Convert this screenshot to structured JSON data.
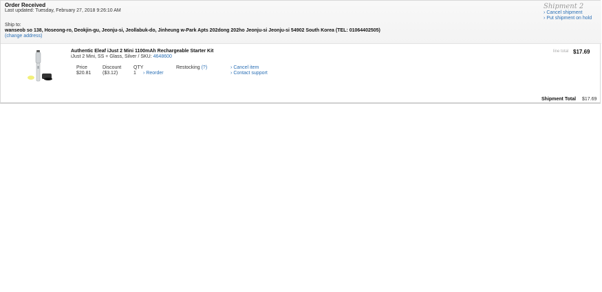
{
  "order": {
    "status": "Order Received",
    "last_updated": "Last updated: Tuesday, February 27, 2018 9:26:10 AM",
    "ship_to_label": "Ship to:",
    "address": "wanseob so 138, Hoseong-ro, Deokjin-gu, Jeonju-si, Jeollabuk-do, Jinheung w-Park Apts 202dong 202ho Jeonju-si Jeonju-si 54902 South Korea (TEL: 01064402505)",
    "change_address": "(change address)"
  },
  "shipment": {
    "title": "Shipment 2",
    "actions": [
      "Cancel shipment",
      "Put shipment on hold"
    ],
    "total_label": "Shipment Total",
    "total": "$17.69"
  },
  "item": {
    "name": "Authentic Eleaf iJust 2 Mini 1100mAh Rechargeable Starter Kit",
    "variant_prefix": "iJust 2 Mini, SS + Glass, Silver / SKU:",
    "sku": "4648600",
    "price_label": "Price",
    "price": "$20.81",
    "discount_label": "Discount",
    "discount": "($3.12)",
    "qty_label": "QTY",
    "qty": "1",
    "reorder": "Reorder",
    "restocking_label": "Restocking",
    "restocking_help": "(?)",
    "cancel_item": "Cancel item",
    "contact_support": "Contact support",
    "line_total_label": "line total",
    "line_total": "$17.69"
  },
  "icons": {
    "arrow": "›",
    "product_image": "vape-kit-image"
  }
}
